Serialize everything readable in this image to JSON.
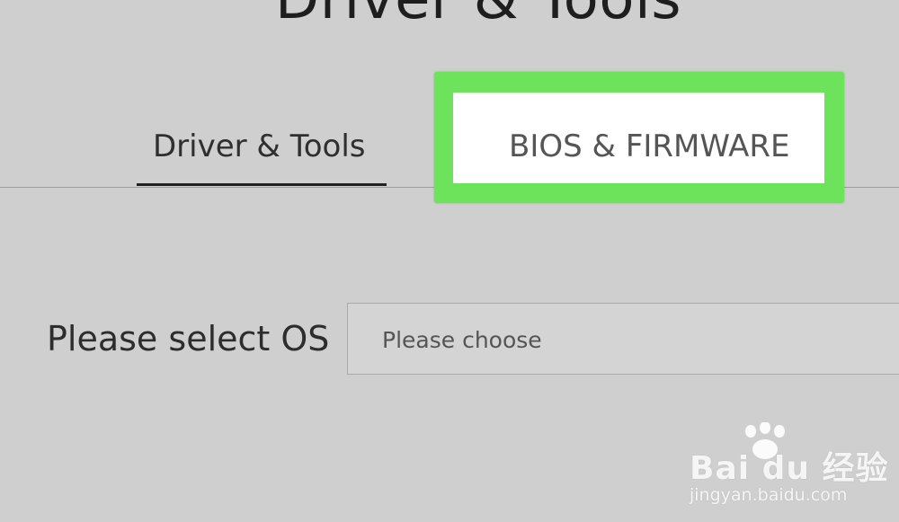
{
  "page": {
    "heading": "Driver & Tools"
  },
  "tabs": [
    {
      "label": "Driver & Tools",
      "active": true
    },
    {
      "label": "BIOS & FIRMWARE",
      "active": false,
      "highlighted": true
    }
  ],
  "os_selector": {
    "label": "Please select OS",
    "value": "Please choose"
  },
  "watermark": {
    "brand": "Bai du 经验",
    "url": "jingyan.baidu.com"
  },
  "colors": {
    "background": "#cfcfcf",
    "highlight": "#6ce35a",
    "active_underline": "#222222"
  }
}
